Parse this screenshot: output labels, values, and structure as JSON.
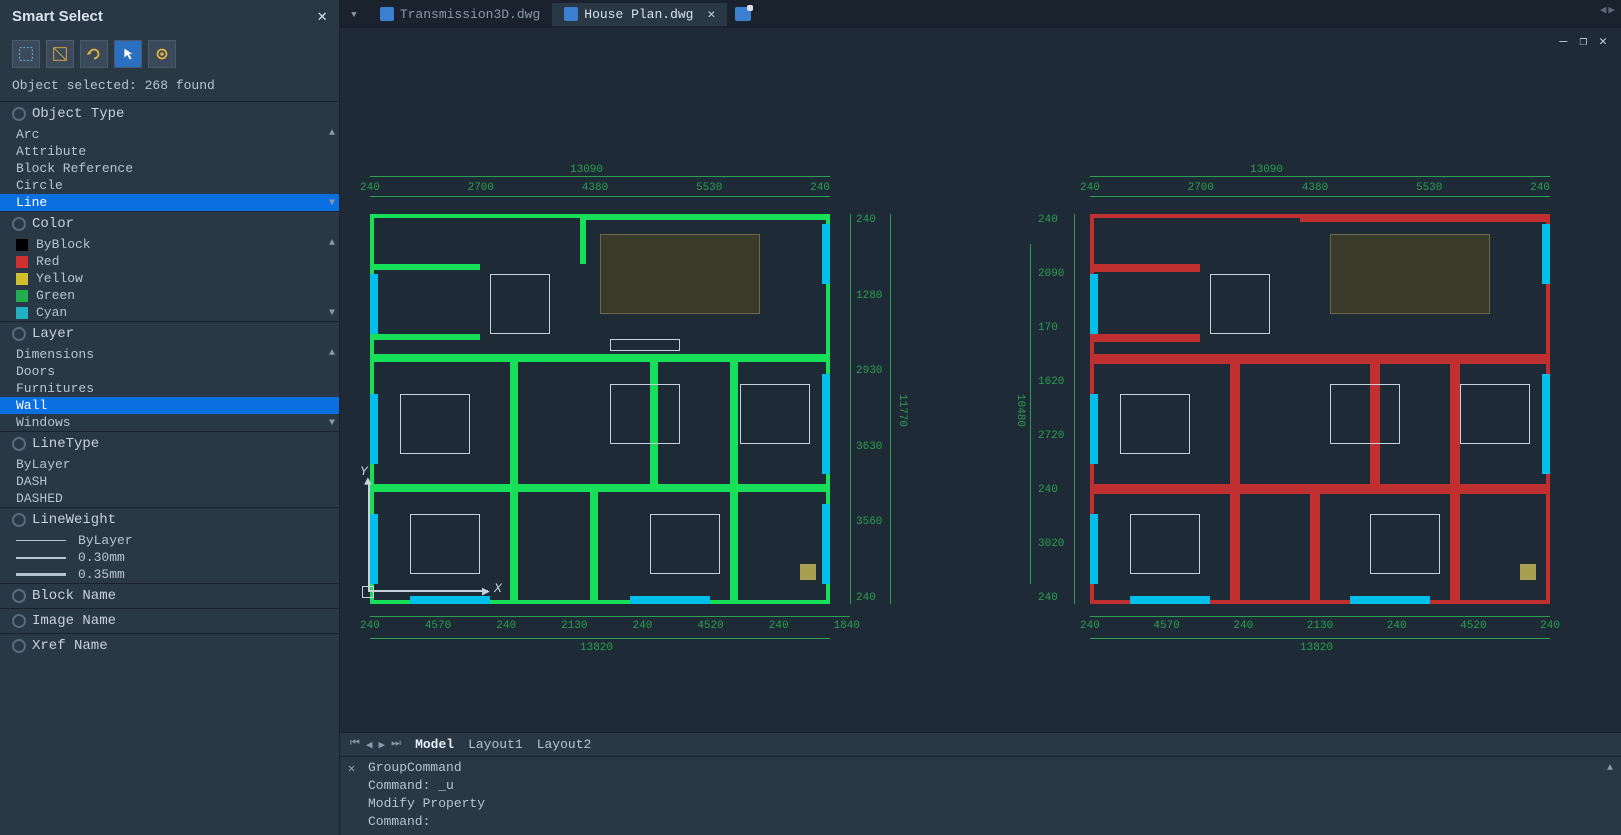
{
  "sidebar": {
    "title": "Smart Select",
    "status": "Object selected: 268 found",
    "sections": {
      "objectType": {
        "title": "Object Type",
        "items": [
          "Arc",
          "Attribute",
          "Block Reference",
          "Circle",
          "Line"
        ],
        "selected": "Line"
      },
      "color": {
        "title": "Color",
        "items": [
          {
            "label": "ByBlock",
            "hex": "#000000"
          },
          {
            "label": "Red",
            "hex": "#d03030"
          },
          {
            "label": "Yellow",
            "hex": "#d0c030"
          },
          {
            "label": "Green",
            "hex": "#20b050"
          },
          {
            "label": "Cyan",
            "hex": "#20b0c0"
          }
        ]
      },
      "layer": {
        "title": "Layer",
        "items": [
          "Dimensions",
          "Doors",
          "Furnitures",
          "Wall",
          "Windows"
        ],
        "selected": "Wall"
      },
      "linetype": {
        "title": "LineType",
        "items": [
          "ByLayer",
          "DASH",
          "DASHED"
        ]
      },
      "lineweight": {
        "title": "LineWeight",
        "items": [
          "ByLayer",
          "0.30mm",
          "0.35mm"
        ]
      },
      "blockName": {
        "title": "Block Name"
      },
      "imageName": {
        "title": "Image Name"
      },
      "xrefName": {
        "title": "Xref Name"
      }
    }
  },
  "tabs": {
    "files": [
      {
        "name": "Transmission3D.dwg",
        "active": false
      },
      {
        "name": "House Plan.dwg",
        "active": true
      }
    ]
  },
  "layoutTabs": {
    "items": [
      "Model",
      "Layout1",
      "Layout2"
    ],
    "active": "Model"
  },
  "command": {
    "lines": [
      "GroupCommand",
      "Command: _u",
      "Modify Property",
      "Command:"
    ]
  },
  "dimensions": {
    "overall_top": "13090",
    "top_row": [
      "240",
      "2700",
      "4380",
      "5530",
      "240"
    ],
    "bottom_overall": "13820",
    "bottom_row": [
      "240",
      "4570",
      "240",
      "2130",
      "240",
      "4520",
      "240",
      "1840"
    ],
    "right_overall": "11770",
    "right_row": [
      "240",
      "1280",
      "2930",
      "3630",
      "3560",
      "240"
    ],
    "left2_row": [
      "240",
      "2090",
      "170",
      "1620",
      "2720",
      "240",
      "3020",
      "240"
    ],
    "left2_overall": "10480",
    "top2_row": [
      "240",
      "2700",
      "4380",
      "5530",
      "240"
    ],
    "bottom2_row": [
      "240",
      "4570",
      "240",
      "2130",
      "240",
      "4520",
      "240"
    ]
  },
  "chart_data": {
    "type": "diagram",
    "note": "Two architectural floor plans of the same house drawn side by side. Left instance has walls highlighted in green (layer Wall selected via Smart Select). Right instance shows the same plan with walls colored red (original wall layer color). Cyan strips along the perimeter represent windows; white line-drawn furniture blocks occupy rooms.",
    "overall_width_mm": 13090,
    "overall_height_mm": 11770,
    "column_widths_mm": [
      240,
      2700,
      4380,
      5530,
      240
    ],
    "row_heights_right_mm": [
      240,
      1280,
      2930,
      3630,
      3560,
      240
    ],
    "bottom_widths_mm": [
      240,
      4570,
      240,
      2130,
      240,
      4520,
      240,
      1840
    ],
    "left_color": "green",
    "right_color": "red"
  }
}
